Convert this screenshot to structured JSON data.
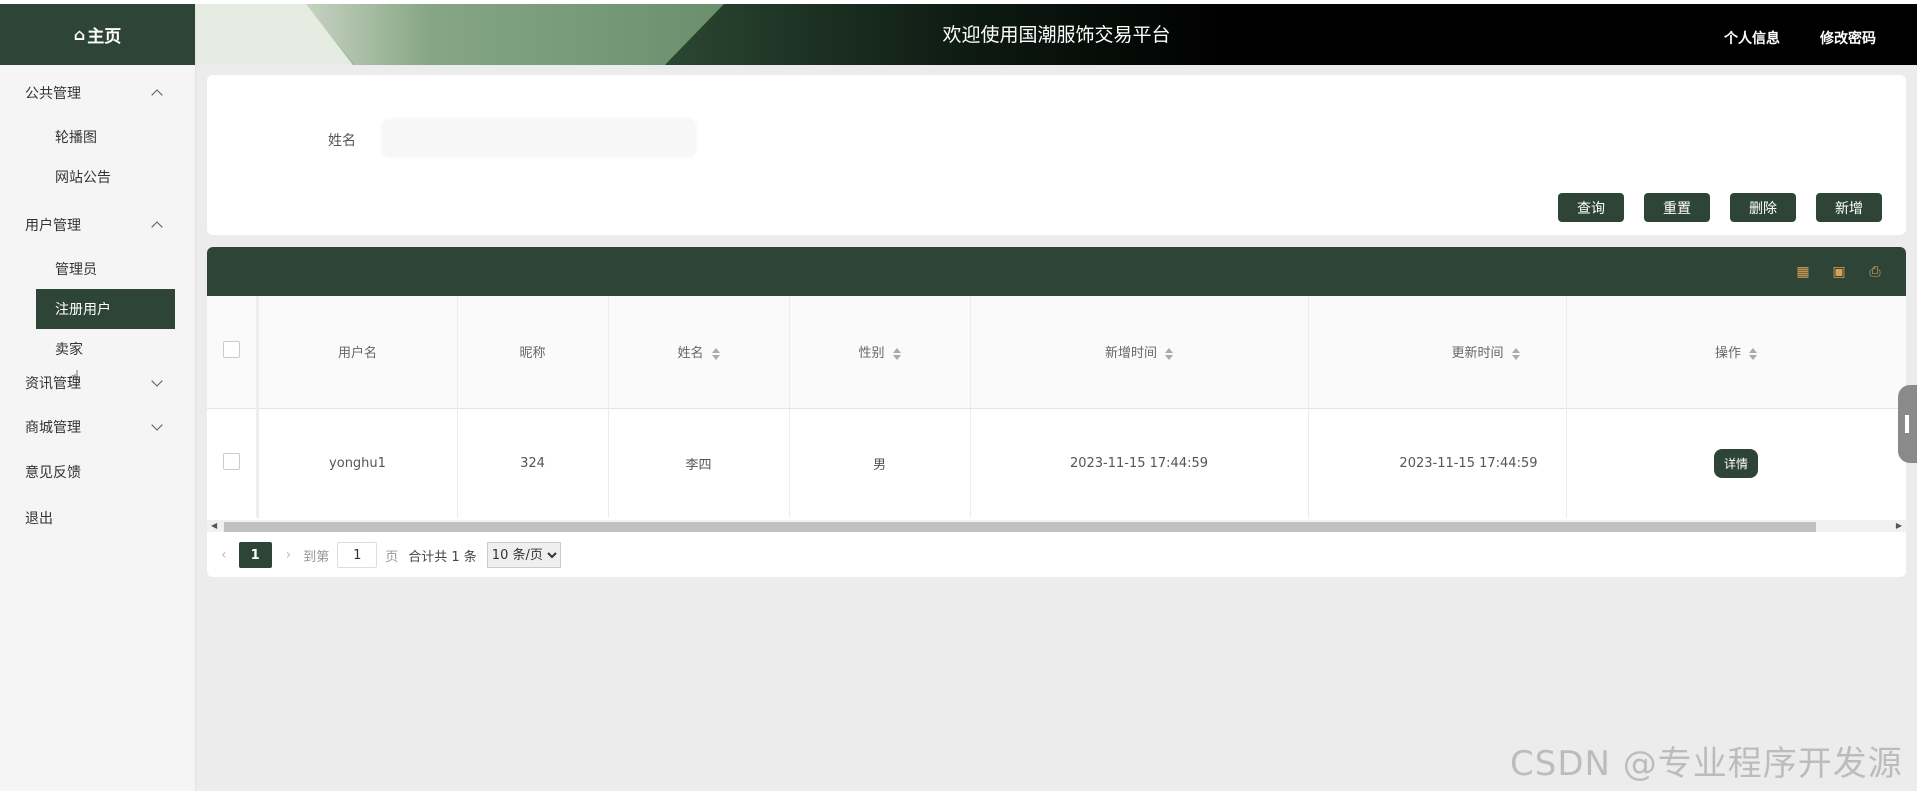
{
  "sidebar": {
    "brand": "主页",
    "brand_icon": "home-icon",
    "groups": [
      {
        "label": "公共管理",
        "items": [
          "轮播图",
          "网站公告"
        ]
      },
      {
        "label": "用户管理",
        "items": [
          "管理员",
          "注册用户",
          "卖家"
        ]
      },
      {
        "label": "资讯管理"
      },
      {
        "label": "商城管理"
      }
    ],
    "singles": [
      "意见反馈",
      "退出"
    ],
    "active_item": "注册用户"
  },
  "header": {
    "title": "欢迎使用国潮服饰交易平台",
    "profile_link": "个人信息",
    "password_link": "修改密码"
  },
  "search": {
    "name_label": "姓名",
    "name_value": "",
    "buttons": {
      "query": "查询",
      "reset": "重置",
      "delete": "删除",
      "add": "新增"
    }
  },
  "table": {
    "columns": [
      "用户名",
      "昵称",
      "姓名",
      "性别",
      "新增时间",
      "更新时间",
      "操作"
    ],
    "rows": [
      {
        "username": "yonghu1",
        "nickname": "324",
        "name": "李四",
        "gender": "男",
        "created": "2023-11-15 17:44:59",
        "updated": "2023-11-15 17:44:59",
        "action": "详情"
      }
    ]
  },
  "pager": {
    "current_page": "1",
    "goto_prefix": "到第",
    "goto_value": "1",
    "goto_suffix": "页",
    "total": "合计共 1 条",
    "page_size": "10 条/页"
  },
  "watermark": "CSDN @专业程序开发源",
  "colors": {
    "primary": "#2e4437",
    "icon_accent": "#d9a056"
  }
}
